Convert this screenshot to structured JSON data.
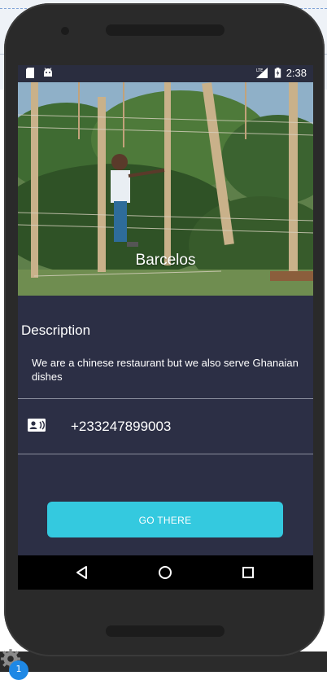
{
  "status_bar": {
    "time": "2:38",
    "network": "LTE"
  },
  "hero": {
    "title": "Barcelos"
  },
  "description": {
    "heading": "Description",
    "text": "We are a chinese restaurant but we also serve Ghanaian dishes"
  },
  "contact": {
    "phone": "+233247899003"
  },
  "action": {
    "go_label": "GO THERE"
  },
  "taskbar": {
    "badge_count": "1"
  },
  "colors": {
    "screen_bg": "#2c2f45",
    "accent": "#34c9df",
    "navbar": "#000000"
  },
  "icons": [
    "sd-card-icon",
    "android-icon",
    "signal-icon",
    "battery-icon",
    "contact-card-icon",
    "back-icon",
    "home-icon",
    "recents-icon",
    "gear-icon"
  ]
}
